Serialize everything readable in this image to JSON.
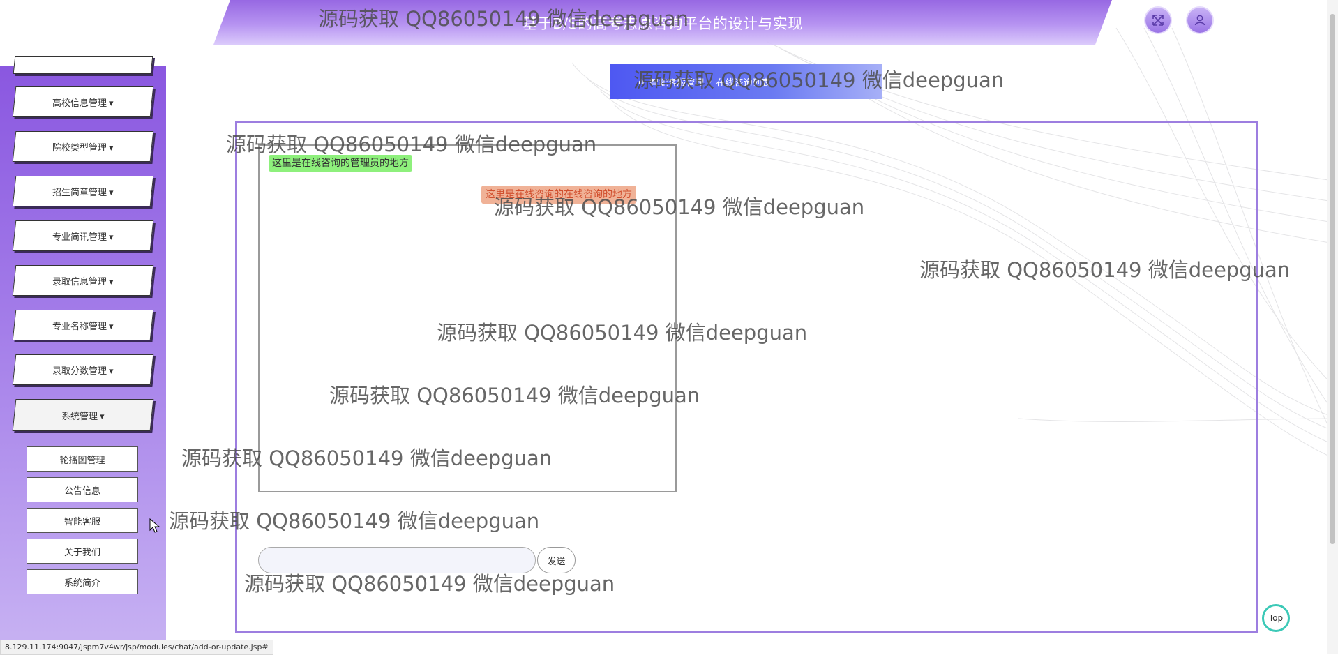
{
  "header": {
    "title": "基于B/S的高考志愿咨询平台的设计与实现"
  },
  "sidebar": {
    "items": [
      {
        "label": "高校信息管理"
      },
      {
        "label": "院校类型管理"
      },
      {
        "label": "招生简章管理"
      },
      {
        "label": "专业简讯管理"
      },
      {
        "label": "录取信息管理"
      },
      {
        "label": "专业名称管理"
      },
      {
        "label": "录取分数管理"
      },
      {
        "label": "系统管理"
      }
    ],
    "caret": "▾",
    "subitems": [
      {
        "label": "轮播图管理"
      },
      {
        "label": "公告信息"
      },
      {
        "label": "智能客服"
      },
      {
        "label": "关于我们"
      },
      {
        "label": "系统简介"
      }
    ]
  },
  "breadcrumb": {
    "items": [
      "智能客服管理",
      "在线咨询列表"
    ]
  },
  "chat": {
    "admin_message": "这里是在线咨询的管理员的地方",
    "user_message": "这里是在线咨询的在线咨询的地方",
    "input_value": "",
    "send_label": "发送"
  },
  "top_button": "Top",
  "status_url": "8.129.11.174:9047/jspm7v4wr/jsp/modules/chat/add-or-update.jsp#",
  "watermark": "源码获取 QQ86050149 微信deepguan",
  "colors": {
    "accent": "#8a57e0",
    "breadcrumb": "#4e58f2",
    "admin_bubble": "#8ef07c",
    "user_bubble": "#f0b297",
    "top_ring": "#3cc9b7"
  }
}
